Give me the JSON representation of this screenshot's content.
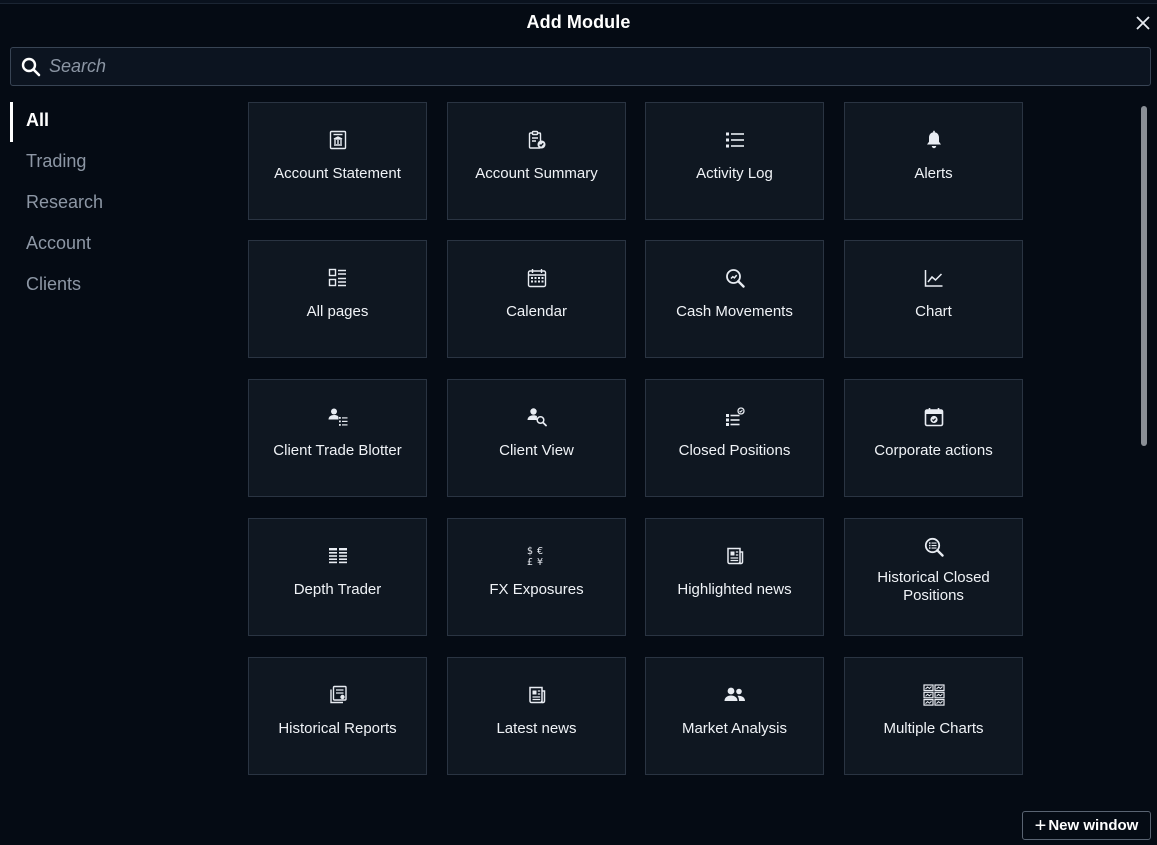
{
  "dialog": {
    "title": "Add Module",
    "close_icon": "close-icon"
  },
  "search": {
    "placeholder": "Search",
    "value": "",
    "icon": "search-icon"
  },
  "sidebar": {
    "items": [
      {
        "label": "All",
        "active": true
      },
      {
        "label": "Trading",
        "active": false
      },
      {
        "label": "Research",
        "active": false
      },
      {
        "label": "Account",
        "active": false
      },
      {
        "label": "Clients",
        "active": false
      }
    ]
  },
  "modules": [
    {
      "label": "Account Statement",
      "icon": "bank-statement-icon"
    },
    {
      "label": "Account Summary",
      "icon": "clipboard-check-icon"
    },
    {
      "label": "Activity Log",
      "icon": "list-icon"
    },
    {
      "label": "Alerts",
      "icon": "bell-icon"
    },
    {
      "label": "All pages",
      "icon": "pages-icon"
    },
    {
      "label": "Calendar",
      "icon": "calendar-icon"
    },
    {
      "label": "Cash Movements",
      "icon": "search-money-icon"
    },
    {
      "label": "Chart",
      "icon": "line-chart-icon"
    },
    {
      "label": "Client Trade Blotter",
      "icon": "user-list-icon"
    },
    {
      "label": "Client View",
      "icon": "user-search-icon"
    },
    {
      "label": "Closed Positions",
      "icon": "list-closed-icon"
    },
    {
      "label": "Corporate actions",
      "icon": "calendar-check-icon"
    },
    {
      "label": "Depth Trader",
      "icon": "depth-table-icon"
    },
    {
      "label": "FX Exposures",
      "icon": "currency-icon"
    },
    {
      "label": "Highlighted news",
      "icon": "news-icon"
    },
    {
      "label": "Historical Closed Positions",
      "icon": "search-list-icon"
    },
    {
      "label": "Historical Reports",
      "icon": "reports-icon"
    },
    {
      "label": "Latest news",
      "icon": "news-icon"
    },
    {
      "label": "Market Analysis",
      "icon": "users-icon"
    },
    {
      "label": "Multiple Charts",
      "icon": "multi-chart-icon"
    }
  ],
  "footer": {
    "new_window_plus": "+",
    "new_window_label": "New window"
  },
  "colors": {
    "background": "#050b14",
    "tile_background": "#0f1721",
    "tile_border": "#2a3442",
    "text_muted": "#8d97a5",
    "text_active": "#ffffff"
  }
}
